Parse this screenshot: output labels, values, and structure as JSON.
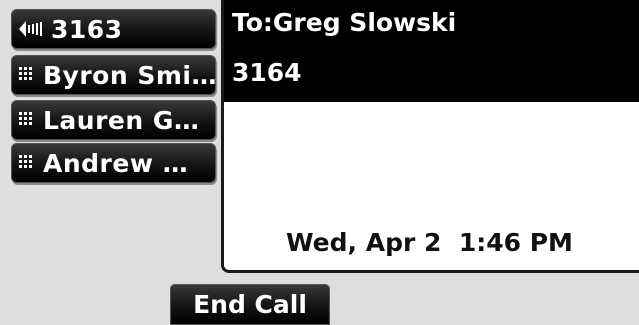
{
  "line_keys": [
    {
      "label": "3163",
      "icon": "speaker-volume-icon"
    },
    {
      "label": "Byron Smi…",
      "icon": "keypad-icon"
    },
    {
      "label": "Lauren G…",
      "icon": "keypad-icon"
    },
    {
      "label": "Andrew …",
      "icon": "keypad-icon"
    }
  ],
  "call": {
    "to": "To:Greg Slowski",
    "number": "3164"
  },
  "status": {
    "datetime": "Wed, Apr 2  1:46 PM"
  },
  "softkeys": {
    "end_call": "End Call"
  }
}
